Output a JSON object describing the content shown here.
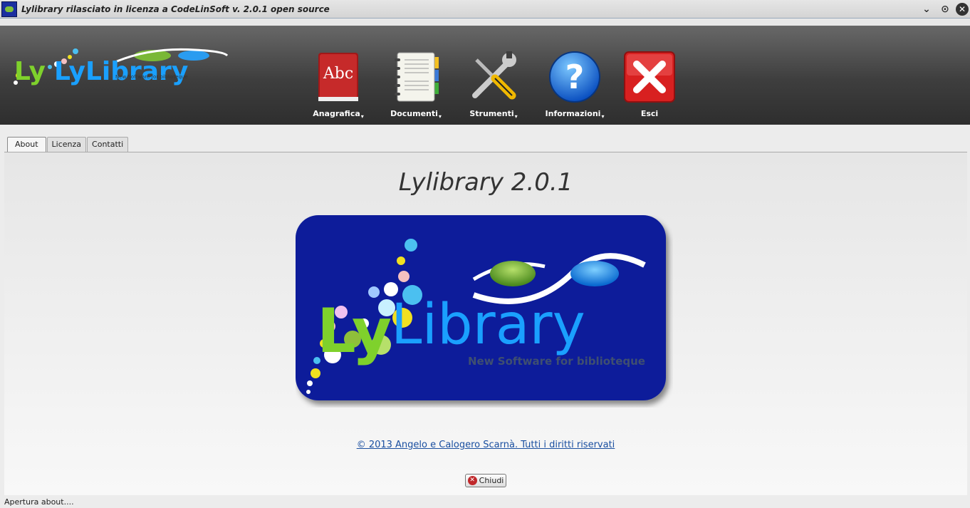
{
  "window": {
    "title": "Lylibrary rilasciato in licenza a CodeLinSoft  v. 2.0.1  open source",
    "controls": [
      "minimize",
      "maximize",
      "close"
    ]
  },
  "toolbar": {
    "logo_text": "LyLibrary",
    "logo_tagline": "New Software for biblioteque",
    "items": [
      {
        "label": "Anagrafica",
        "icon": "dictionary-book-icon",
        "has_menu": true
      },
      {
        "label": "Documenti",
        "icon": "notebook-icon",
        "has_menu": true
      },
      {
        "label": "Strumenti",
        "icon": "tools-icon",
        "has_menu": true
      },
      {
        "label": "Informazioni",
        "icon": "help-icon",
        "has_menu": true
      },
      {
        "label": "Esci",
        "icon": "exit-icon",
        "has_menu": false
      }
    ]
  },
  "tabs": [
    {
      "label": "About",
      "active": true
    },
    {
      "label": "Licenza",
      "active": false
    },
    {
      "label": "Contatti",
      "active": false
    }
  ],
  "about": {
    "heading": "Lylibrary 2.0.1",
    "logo_text_ly": "Ly",
    "logo_text_library": "Library",
    "logo_tagline": "New Software for biblioteque",
    "copyright_link": "© 2013 Angelo e Calogero Scarnà. Tutti i diritti riservati",
    "close_button": "Chiudi"
  },
  "status": {
    "text": "Apertura about...."
  },
  "colors": {
    "logo_background": "#0a1f9a",
    "logo_green": "#7fd12c",
    "logo_blue": "#1aa0ff",
    "link": "#1a4fa0"
  }
}
